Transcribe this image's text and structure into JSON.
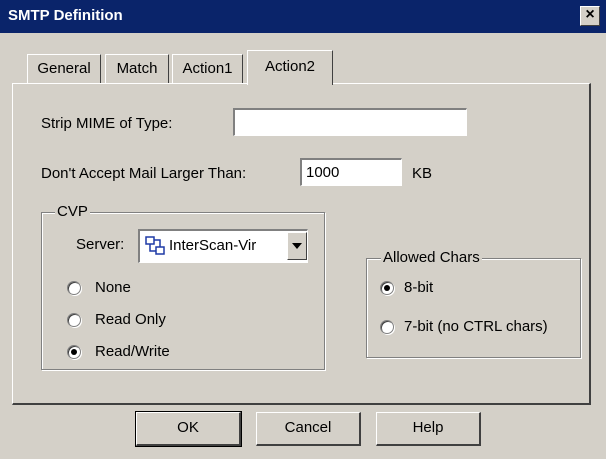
{
  "window": {
    "title": "SMTP Definition",
    "close_glyph": "×"
  },
  "tabs": [
    {
      "label": "General",
      "active": false
    },
    {
      "label": "Match",
      "active": false
    },
    {
      "label": "Action1",
      "active": false
    },
    {
      "label": "Action2",
      "active": true
    }
  ],
  "strip_mime": {
    "label": "Strip MIME of Type:",
    "value": ""
  },
  "max_size": {
    "label": "Don't Accept Mail Larger Than:",
    "value": "1000",
    "unit": "KB"
  },
  "cvp": {
    "title": "CVP",
    "server_label": "Server:",
    "server_value": "InterScan-Vir",
    "options": [
      {
        "label": "None",
        "selected": false
      },
      {
        "label": "Read Only",
        "selected": false
      },
      {
        "label": "Read/Write",
        "selected": true
      }
    ]
  },
  "allowed_chars": {
    "title": "Allowed Chars",
    "options": [
      {
        "label": "8-bit",
        "selected": true
      },
      {
        "label": "7-bit (no CTRL chars)",
        "selected": false
      }
    ]
  },
  "buttons": {
    "ok": "OK",
    "cancel": "Cancel",
    "help": "Help"
  },
  "icons": {
    "server": "server-network-icon",
    "dropdown": "dropdown-arrow-icon",
    "close": "close-icon"
  },
  "colors": {
    "titlebar": "#0a246a",
    "face": "#d4d0c8"
  }
}
